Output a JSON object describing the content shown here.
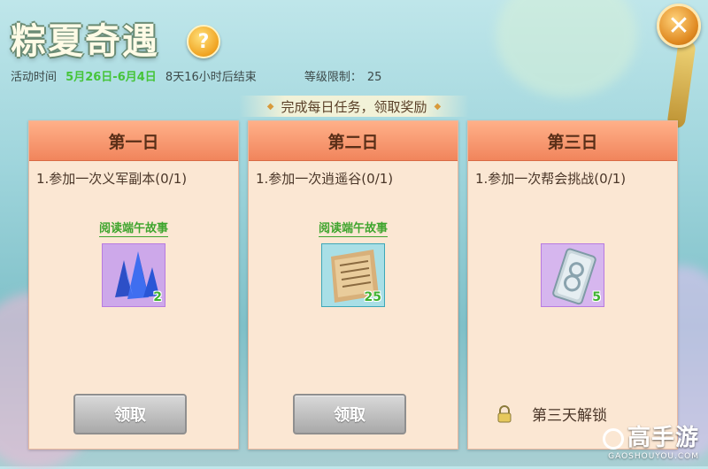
{
  "header": {
    "title": "粽夏奇遇",
    "help_symbol": "?",
    "close_symbol": "✕",
    "activity_time_label": "活动时间",
    "activity_dates": "5月26日-6月4日",
    "time_remaining": "8天16小时后结束",
    "level_limit_label": "等级限制：",
    "level_limit_value": "25"
  },
  "banner": {
    "text": "完成每日任务，领取奖励"
  },
  "cards": [
    {
      "day": "第一日",
      "task": "1.参加一次义军副本(0/1)",
      "story_link": "阅读端午故事",
      "reward": {
        "icon": "crystal-icon",
        "count": "2"
      },
      "claim_label": "领取"
    },
    {
      "day": "第二日",
      "task": "1.参加一次逍遥谷(0/1)",
      "story_link": "阅读端午故事",
      "reward": {
        "icon": "scroll-icon",
        "count": "25"
      },
      "claim_label": "领取"
    },
    {
      "day": "第三日",
      "task": "1.参加一次帮会挑战(0/1)",
      "reward": {
        "icon": "silver-ticket-icon",
        "count": "5"
      },
      "unlock_text": "第三天解锁"
    }
  ],
  "watermark": {
    "name": "高手游",
    "url": "GAOSHOUYOU.COM"
  },
  "colors": {
    "accent_green": "#46c43a",
    "card_header": "#f1855c",
    "card_bg": "#fbe7d3",
    "button_disabled": "#a9a9a9"
  }
}
